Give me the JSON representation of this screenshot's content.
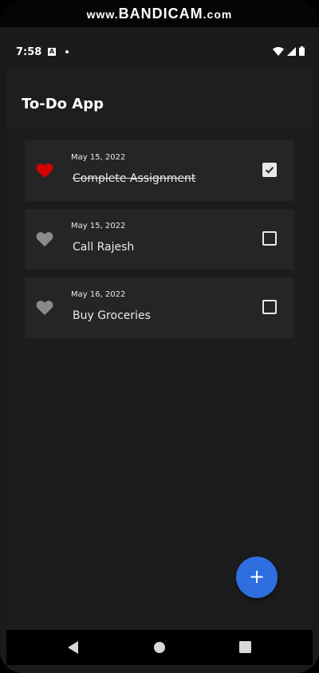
{
  "watermark": {
    "prefix": "www.",
    "brand": "BANDICAM",
    "suffix": ".com"
  },
  "status_bar": {
    "time": "7:58",
    "icons": [
      "notification-a-icon",
      "dot-icon",
      "wifi-icon",
      "signal-icon",
      "battery-icon"
    ]
  },
  "app": {
    "title": "To-Do App"
  },
  "tasks": [
    {
      "date": "May 15, 2022",
      "title": "Complete Assignment",
      "favorite": true,
      "completed": true
    },
    {
      "date": "May 15, 2022",
      "title": "Call Rajesh",
      "favorite": false,
      "completed": false
    },
    {
      "date": "May 16, 2022",
      "title": "Buy Groceries",
      "favorite": false,
      "completed": false
    }
  ],
  "fab": {
    "label": "+"
  },
  "colors": {
    "favorite_on": "#d40000",
    "favorite_off": "#8a8a8a",
    "fab": "#2f6ee0",
    "card": "#252525",
    "background": "#1c1c1c"
  },
  "nav_bar": {
    "icons": [
      "back-icon",
      "home-icon",
      "recents-icon"
    ]
  }
}
